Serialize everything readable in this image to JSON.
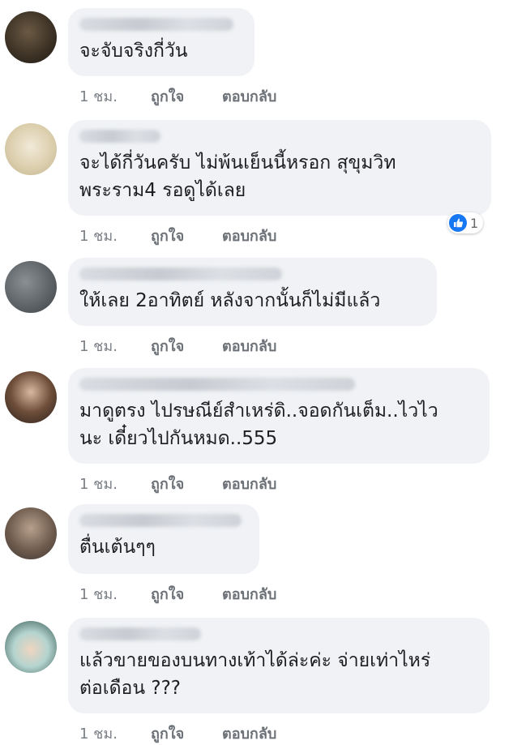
{
  "comments": [
    {
      "text": "จะจับจริงกี่วัน",
      "time": "1 ชม.",
      "like": "ถูกใจ",
      "reply": "ตอบกลับ"
    },
    {
      "text": "จะได้กี่วันครับ ไม่พ้นเย็นนี้หรอก สุขุมวิท\nพระราม4 รอดูได้เลย",
      "time": "1 ชม.",
      "like": "ถูกใจ",
      "reply": "ตอบกลับ",
      "reaction_count": "1"
    },
    {
      "text": "ให้เลย 2อาทิตย์ หลังจากนั้นก็ไม่มีแล้ว",
      "time": "1 ชม.",
      "like": "ถูกใจ",
      "reply": "ตอบกลับ"
    },
    {
      "text": "มาดูตรง ไปรษณีย์สำเหร่ดิ..จอดกันเต็ม..ไวไว\nนะ เดี๋ยวไปกันหมด..555",
      "time": "1 ชม.",
      "like": "ถูกใจ",
      "reply": "ตอบกลับ"
    },
    {
      "text": "ตื่นเต้นๆๆ",
      "time": "1 ชม.",
      "like": "ถูกใจ",
      "reply": "ตอบกลับ"
    },
    {
      "text": "แล้วขายของบนทางเท้าได้ล่ะค่ะ จ่ายเท่าไหร่\nต่อเดือน ???",
      "time": "1 ชม.",
      "like": "ถูกใจ",
      "reply": "ตอบกลับ"
    }
  ],
  "colors": {
    "bubble": "#f0f2f5",
    "text": "#1c1e21",
    "meta": "#7b8087",
    "like_blue": "#1877f2"
  }
}
